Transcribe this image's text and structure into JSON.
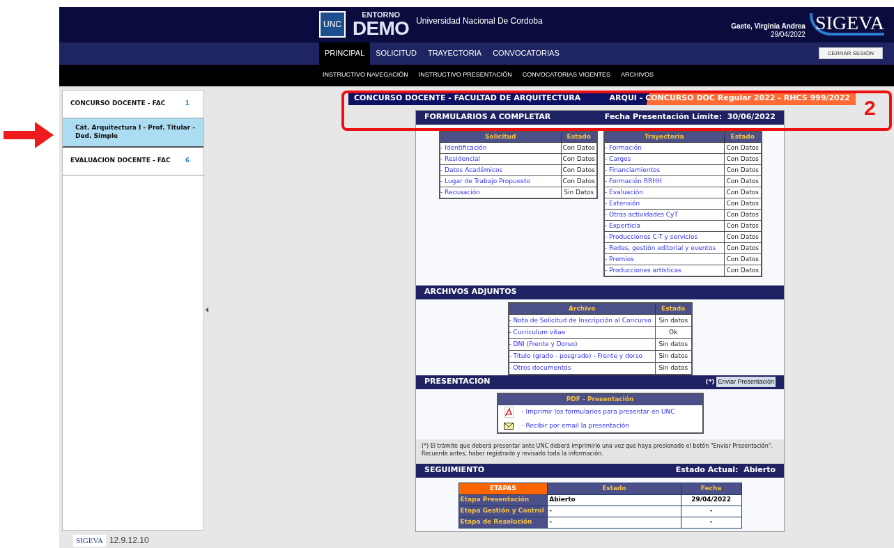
{
  "header": {
    "logo_box": "UNC",
    "env_small": "ENTORNO",
    "env_big": "DEMO",
    "university": "Universidad Nacional De Cordoba",
    "user_name": "Gaete, Virginia Andrea",
    "date": "29/04/2022",
    "brand": "SIGEVA"
  },
  "nav": [
    {
      "label": "PRINCIPAL",
      "selected": true
    },
    {
      "label": "SOLICITUD",
      "selected": false
    },
    {
      "label": "TRAYECTORIA",
      "selected": false
    },
    {
      "label": "CONVOCATORIAS",
      "selected": false
    }
  ],
  "logout": "CERRAR SESIÓN",
  "subnav": [
    "INSTRUCTIVO NAVEGACIÓN",
    "INSTRUCTIVO PRESENTACIÓN",
    "CONVOCATORIAS VIGENTES",
    "ARCHIVOS"
  ],
  "sidebar": {
    "items": [
      {
        "label": "CONCURSO DOCENTE - FAC",
        "count": "1",
        "selected": false,
        "children": [
          {
            "label": "Cát. Arquitectura I - Prof. Titular - Ded. Simple",
            "selected": true
          }
        ]
      },
      {
        "label": "EVALUACION DOCENTE - FAC",
        "count": "6",
        "selected": false
      }
    ]
  },
  "version": {
    "brand": "SIGEVA",
    "number": "12.9.12.10"
  },
  "context_bar": {
    "left": "CONCURSO DOCENTE - FACULTAD DE ARQUITECTURA",
    "right": "ARQUI - CONCURSO DOC Regular 2022 - RHCS 999/2022"
  },
  "forms": {
    "title": "FORMULARIOS A COMPLETAR",
    "deadline_label": "Fecha Presentación Límite:",
    "deadline": "30/06/2022",
    "tables": [
      {
        "columns": [
          "Solicitud",
          "Estado"
        ],
        "rows": [
          {
            "label": "- Identificación",
            "status": "Con Datos"
          },
          {
            "label": "- Residencial",
            "status": "Con Datos"
          },
          {
            "label": "- Datos Académicos",
            "status": "Con Datos"
          },
          {
            "label": "- Lugar de Trabajo Propuesto",
            "status": "Con Datos"
          },
          {
            "label": "- Recusación",
            "status": "Sin Datos"
          }
        ]
      },
      {
        "columns": [
          "Trayectoria",
          "Estado"
        ],
        "rows": [
          {
            "label": "- Formación",
            "status": "Con Datos"
          },
          {
            "label": "- Cargos",
            "status": "Con Datos"
          },
          {
            "label": "- Financiamientos",
            "status": "Con Datos"
          },
          {
            "label": "- Formación RRHH",
            "status": "Con Datos"
          },
          {
            "label": "- Evaluación",
            "status": "Con Datos"
          },
          {
            "label": "- Extensión",
            "status": "Con Datos"
          },
          {
            "label": "- Otras actividades CyT",
            "status": "Con Datos"
          },
          {
            "label": "- Experticia",
            "status": "Con Datos"
          },
          {
            "label": "- Producciones C-T y servicios",
            "status": "Con Datos"
          },
          {
            "label": "- Redes, gestión editorial y eventos",
            "status": "Con Datos"
          },
          {
            "label": "- Premios",
            "status": "Con Datos"
          },
          {
            "label": "- Producciones artísticas",
            "status": "Con Datos"
          }
        ]
      }
    ]
  },
  "attachments": {
    "title": "ARCHIVOS ADJUNTOS",
    "columns": [
      "Archivo",
      "Estado"
    ],
    "rows": [
      {
        "label": "- Nota de Solicitud de Inscripción al Concurso",
        "status": "Sin datos"
      },
      {
        "label": "- Curriculum vitae",
        "status": "Ok"
      },
      {
        "label": "- DNI (Frente y Dorso)",
        "status": "Sin datos"
      },
      {
        "label": "- Titulo (grado - posgrado) - Frente y dorso",
        "status": "Sin datos"
      },
      {
        "label": "- Otros documentos",
        "status": "Sin datos"
      }
    ]
  },
  "presentation": {
    "title": "PRESENTACION",
    "asterisk": "(*)",
    "button": "Enviar Presentación",
    "box_title": "PDF - Presentación",
    "links": [
      {
        "kind": "pdf",
        "label": "- Imprimir los formularios para presentar en UNC"
      },
      {
        "kind": "email",
        "label": "- Recibir por email la presentación"
      }
    ],
    "footnote": "(*) El trámite que deberá presentar ante UNC deberá imprimirlo una vez que haya presionado el botón \"Enviar Presentación\". Recuerde antes, haber registrado y revisado toda la información."
  },
  "tracking": {
    "title": "SEGUIMIENTO",
    "state_label": "Estado Actual:",
    "state": "Abierto",
    "columns": [
      "ETAPAS",
      "Estado",
      "Fecha"
    ],
    "rows": [
      {
        "stage": "Etapa Presentación",
        "status": "Abierto",
        "date": "29/04/2022"
      },
      {
        "stage": "Etapa Gestión y Control",
        "status": "-",
        "date": "-"
      },
      {
        "stage": "Etapa de Resolución",
        "status": "-",
        "date": "-"
      }
    ]
  },
  "annotations": {
    "box_label": "2"
  }
}
